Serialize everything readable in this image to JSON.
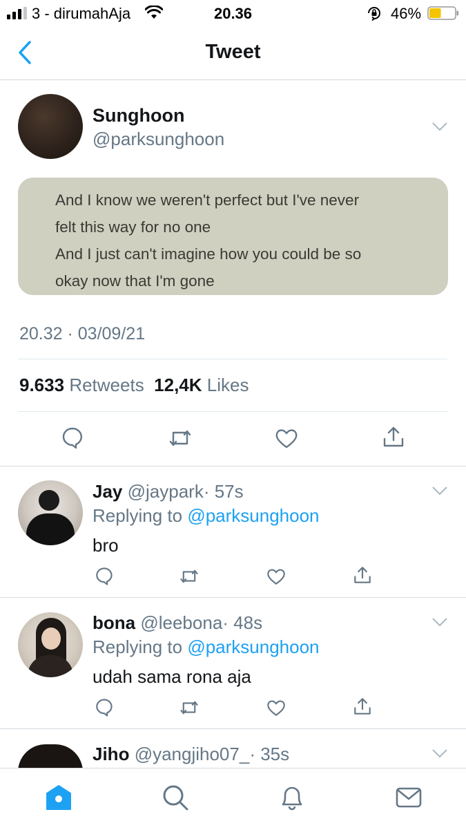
{
  "status_bar": {
    "carrier": "3 - dirumahAja",
    "time": "20.36",
    "battery_percent": "46%",
    "battery_level": 0.46,
    "icons": [
      "signal-icon",
      "wifi-icon",
      "orientation-lock-icon",
      "battery-icon"
    ]
  },
  "header": {
    "title": "Tweet",
    "back_icon": "chevron-left-icon"
  },
  "main_tweet": {
    "name": "Sunghoon",
    "handle": "@parksunghoon",
    "image_text": [
      "And I know we weren't perfect but I've never",
      "felt this way for no one",
      "And I just can't imagine how you could be so",
      "okay now that I'm gone"
    ],
    "timestamp": "20.32 · 03/09/21",
    "retweets_count": "9.633",
    "retweets_label": "Retweets",
    "likes_count": "12,4K",
    "likes_label": "Likes",
    "actions": [
      "reply-icon",
      "retweet-icon",
      "like-icon",
      "share-icon"
    ]
  },
  "replies": [
    {
      "name": "Jay",
      "handle": "@jaypark",
      "time": "· 57s",
      "replying_prefix": "Replying to",
      "replying_to": "@parksunghoon",
      "text": "bro"
    },
    {
      "name": "bona",
      "handle": "@leebona",
      "time": "· 48s",
      "replying_prefix": "Replying to",
      "replying_to": "@parksunghoon",
      "text": "udah sama rona aja"
    },
    {
      "name": "Jiho",
      "handle": "@yangjiho07_",
      "time": "· 35s"
    }
  ],
  "tab_bar": {
    "items": [
      "home-icon",
      "search-icon",
      "notifications-icon",
      "messages-icon"
    ],
    "active": "home-icon",
    "accent_color": "#1da1f2"
  },
  "colors": {
    "accent": "#1da1f2",
    "secondary_text": "#657786",
    "primary_text": "#14171a",
    "image_background": "#cfd0c0"
  }
}
